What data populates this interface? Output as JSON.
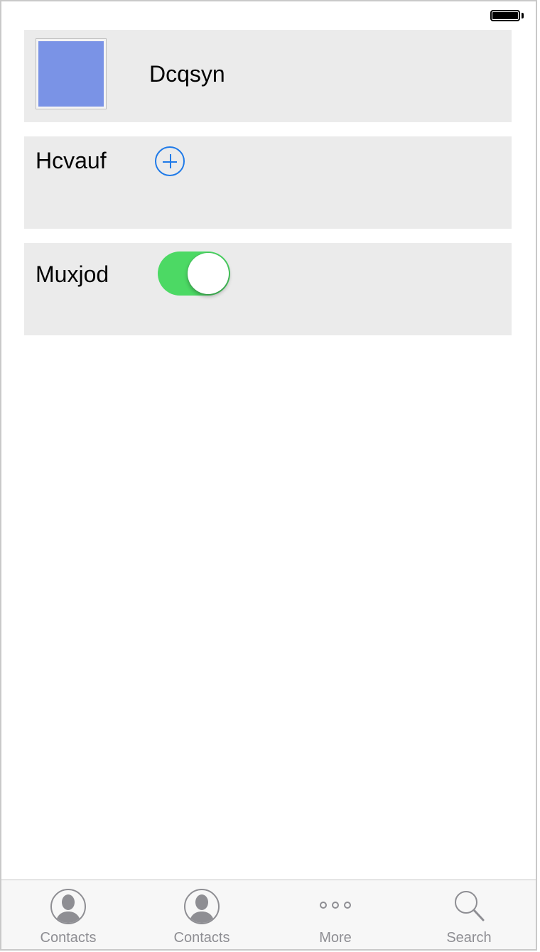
{
  "status_bar": {
    "battery_icon": "battery-full-icon"
  },
  "rows": [
    {
      "title": "Dcqsyn",
      "thumbnail_color": "#7a93e6"
    },
    {
      "title": "Hcvauf",
      "action_icon": "add-circle-icon",
      "accent_color": "#1f7ae8"
    },
    {
      "title": "Muxjod",
      "toggle_on": true,
      "toggle_color": "#4cd964"
    }
  ],
  "tab_bar": {
    "items": [
      {
        "label": "Contacts",
        "icon": "contact-person-icon"
      },
      {
        "label": "Contacts",
        "icon": "contact-person-icon"
      },
      {
        "label": "More",
        "icon": "more-dots-icon"
      },
      {
        "label": "Search",
        "icon": "search-icon"
      }
    ],
    "label_color": "#8e8e93"
  }
}
